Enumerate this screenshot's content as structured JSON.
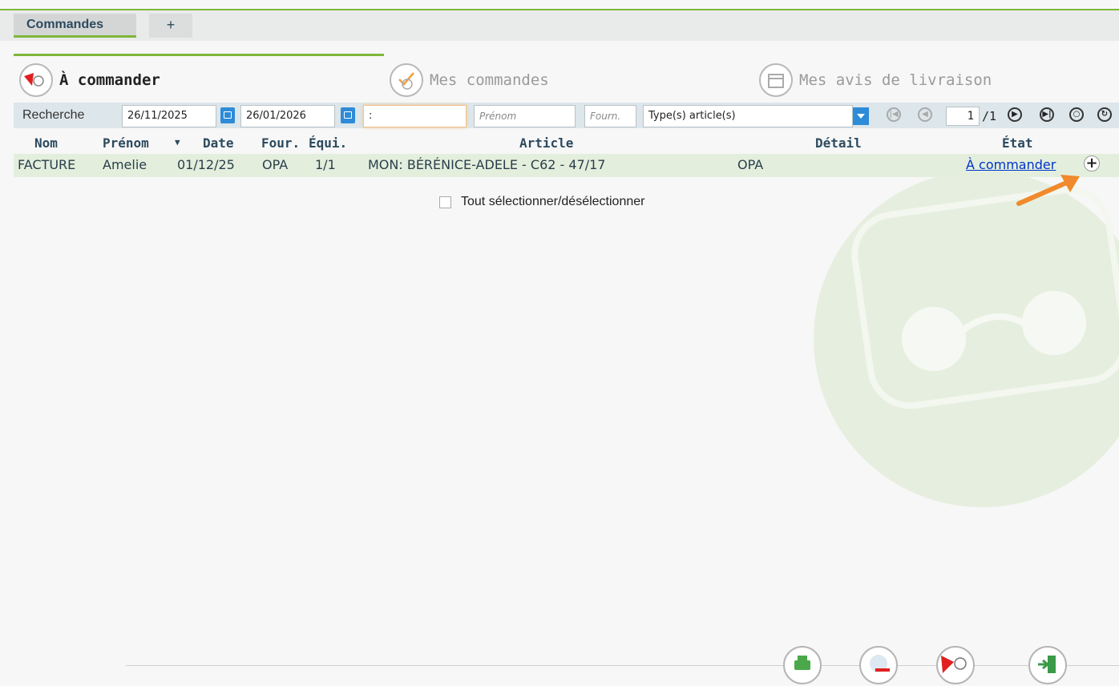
{
  "tabs": {
    "active_label": "Commandes",
    "add_label": "+"
  },
  "sections": {
    "a_commander": "À commander",
    "mes_commandes": "Mes commandes",
    "mes_avis": "Mes avis de livraison"
  },
  "search": {
    "label": "Recherche",
    "date_from": "26/11/2025",
    "date_to": "26/01/2026",
    "name_value": ":",
    "prenom_placeholder": "Prénom",
    "fourn_placeholder": "Fourn.",
    "type_article": "Type(s) article(s)",
    "page_current": "1",
    "page_total": "/1"
  },
  "table": {
    "headers": {
      "nom": "Nom",
      "prenom": "Prénom",
      "date": "Date",
      "four": "Four.",
      "equi": "Équi.",
      "article": "Article",
      "detail": "Détail",
      "etat": "État"
    },
    "rows": [
      {
        "nom": "FACTURE",
        "prenom": "Amelie",
        "date": "01/12/25",
        "four": "OPA",
        "equi": "1/1",
        "article": "MON: BÉRÉNICE-ADELE - C62 - 47/17",
        "detail": "OPA",
        "etat": "À commander"
      }
    ]
  },
  "select_all_label": "Tout sélectionner/désélectionner",
  "colors": {
    "accent_green": "#7fb63a",
    "link_blue": "#0033cc",
    "annotation_arrow": "#f08a2c",
    "icon_blue": "#2d8bd8"
  },
  "icons": [
    "glasses-order-icon",
    "glasses-check-icon",
    "box-delivery-icon",
    "calendar-icon",
    "dropdown-arrow-icon",
    "first-page-icon",
    "prev-page-icon",
    "next-page-icon",
    "last-page-icon",
    "search-icon",
    "refresh-icon",
    "plus-icon",
    "print-icon",
    "remove-lens-icon",
    "order-glasses-icon",
    "exit-icon",
    "annotation-arrow"
  ]
}
